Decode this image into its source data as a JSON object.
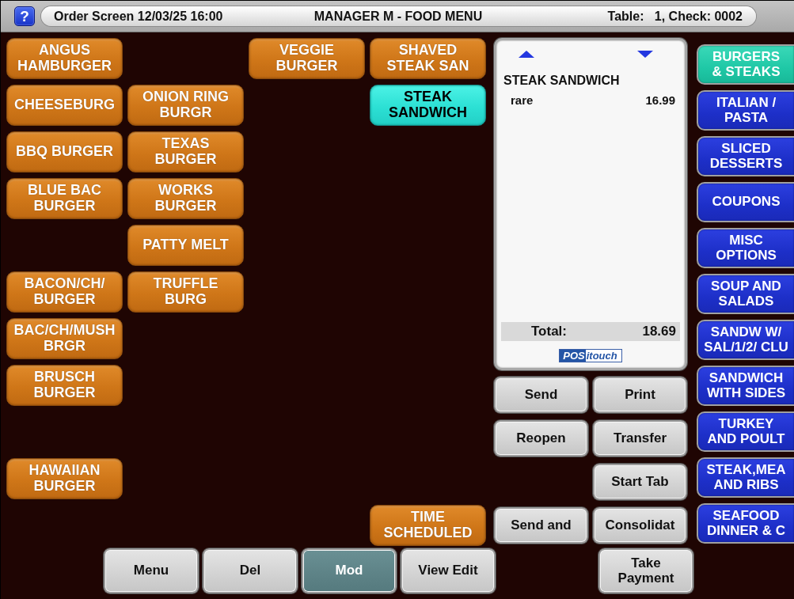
{
  "header": {
    "help_label": "?",
    "screen_info": "Order Screen 12/03/25 16:00",
    "title": "MANAGER M - FOOD MENU",
    "check_info": "Table:   1, Check: 0002"
  },
  "menu_items": [
    {
      "label": "ANGUS\nHAMBURGER",
      "selected": false
    },
    {
      "label": "VEGGIE\nBURGER",
      "selected": false
    },
    {
      "label": "SHAVED\nSTEAK SAN",
      "selected": false
    },
    {
      "label": "CHEESEBURG",
      "selected": false
    },
    {
      "label": "ONION RING\nBURGR",
      "selected": false
    },
    {
      "label": "STEAK\nSANDWICH",
      "selected": true
    },
    {
      "label": "BBQ BURGER",
      "selected": false
    },
    {
      "label": "TEXAS\nBURGER",
      "selected": false
    },
    {
      "label": "BLUE BAC\nBURGER",
      "selected": false
    },
    {
      "label": "WORKS\nBURGER",
      "selected": false
    },
    {
      "label": "PATTY MELT",
      "selected": false
    },
    {
      "label": "BACON/CH/\nBURGER",
      "selected": false
    },
    {
      "label": "TRUFFLE\nBURG",
      "selected": false
    },
    {
      "label": "BAC/CH/MUSH\nBRGR",
      "selected": false
    },
    {
      "label": "BRUSCH\nBURGER",
      "selected": false
    },
    {
      "label": "HAWAIIAN\nBURGER",
      "selected": false
    },
    {
      "label": "TIME\nSCHEDULED",
      "selected": false
    }
  ],
  "order": {
    "lines": [
      {
        "kind": "item",
        "text": "STEAK SANDWICH"
      },
      {
        "kind": "modifier",
        "text": "rare",
        "price": "16.99"
      }
    ],
    "total_label": "Total:",
    "total": "18.69",
    "logo": [
      "POS",
      "itouch"
    ]
  },
  "actions": [
    {
      "label": "Send"
    },
    {
      "label": "Print"
    },
    {
      "label": "Reopen"
    },
    {
      "label": "Transfer"
    },
    {
      "label": "Start Tab"
    },
    {
      "label": "Send and"
    },
    {
      "label": "Consolidat"
    }
  ],
  "categories": [
    {
      "label": "BURGERS\n& STEAKS",
      "selected": true
    },
    {
      "label": "ITALIAN /\nPASTA",
      "selected": false
    },
    {
      "label": "SLICED\nDESSERTS",
      "selected": false
    },
    {
      "label": "COUPONS",
      "selected": false
    },
    {
      "label": "MISC\nOPTIONS",
      "selected": false
    },
    {
      "label": "SOUP AND\nSALADS",
      "selected": false
    },
    {
      "label": "SANDW W/\nSAL/1/2/ CLU",
      "selected": false
    },
    {
      "label": "SANDWICH\nWITH SIDES",
      "selected": false
    },
    {
      "label": "TURKEY\nAND POULT",
      "selected": false
    },
    {
      "label": "STEAK,MEA\nAND RIBS",
      "selected": false
    },
    {
      "label": "SEAFOOD\nDINNER & C",
      "selected": false
    }
  ],
  "function_keys": [
    {
      "label": "Menu",
      "selected": false
    },
    {
      "label": "Del",
      "selected": false
    },
    {
      "label": "Mod",
      "selected": true
    },
    {
      "label": "View Edit",
      "selected": false
    },
    {
      "label": "Take\nPayment",
      "selected": false
    }
  ]
}
